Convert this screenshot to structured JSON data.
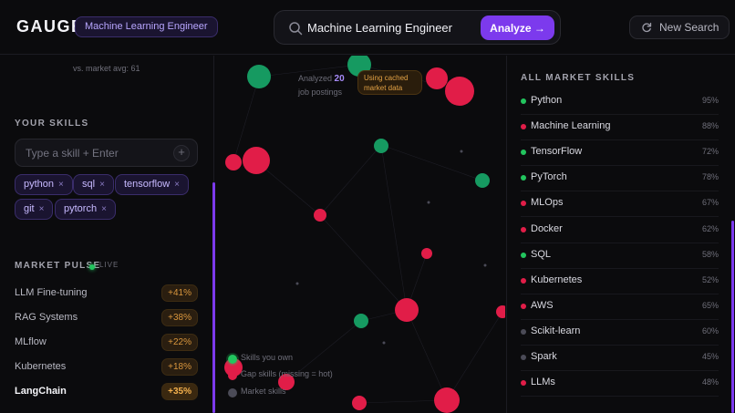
{
  "header": {
    "logo": "GAUGE",
    "role_badge": "Machine Learning Engineer",
    "search_value": "Machine Learning Engineer",
    "analyze_label": "Analyze →",
    "new_search_label": "New Search"
  },
  "left": {
    "market_avg_text": "vs. market avg: 61",
    "your_skills_title": "YOUR SKILLS",
    "skill_input_placeholder": "Type a skill + Enter",
    "add_symbol": "+",
    "chips": [
      "python",
      "sql",
      "tensorflow",
      "git",
      "pytorch"
    ],
    "chip_remove": "×",
    "market_pulse_title": "MARKET PULSE",
    "live_label": "LIVE",
    "pulse": [
      {
        "name": "LLM Fine-tuning",
        "delta": "+41%"
      },
      {
        "name": "RAG Systems",
        "delta": "+38%"
      },
      {
        "name": "MLflow",
        "delta": "+22%"
      },
      {
        "name": "Kubernetes",
        "delta": "+18%"
      },
      {
        "name": "LangChain",
        "delta": "+35%"
      }
    ]
  },
  "center": {
    "analyzed_prefix": "Analyzed",
    "analyzed_count": "20",
    "analyzed_suffix": "job postings",
    "cached_badge": "Using cached market data",
    "legend": [
      {
        "label": "Skills you own",
        "color": "#22c55e"
      },
      {
        "label": "Gap skills (missing = hot)",
        "color": "#e11d48"
      },
      {
        "label": "Market skills",
        "color": "#4b4b57"
      }
    ]
  },
  "right": {
    "title": "ALL MARKET SKILLS",
    "skills": [
      {
        "name": "Python",
        "pct": "95%",
        "color": "#22c55e"
      },
      {
        "name": "Machine Learning",
        "pct": "88%",
        "color": "#e11d48"
      },
      {
        "name": "TensorFlow",
        "pct": "72%",
        "color": "#22c55e"
      },
      {
        "name": "PyTorch",
        "pct": "78%",
        "color": "#22c55e"
      },
      {
        "name": "MLOps",
        "pct": "67%",
        "color": "#e11d48"
      },
      {
        "name": "Docker",
        "pct": "62%",
        "color": "#e11d48"
      },
      {
        "name": "SQL",
        "pct": "58%",
        "color": "#22c55e"
      },
      {
        "name": "Kubernetes",
        "pct": "52%",
        "color": "#e11d48"
      },
      {
        "name": "AWS",
        "pct": "65%",
        "color": "#e11d48"
      },
      {
        "name": "Scikit-learn",
        "pct": "60%",
        "color": "#4b4b57"
      },
      {
        "name": "Spark",
        "pct": "45%",
        "color": "#4b4b57"
      },
      {
        "name": "LLMs",
        "pct": "48%",
        "color": "#e11d48"
      }
    ]
  },
  "colors": {
    "accent": "#7c3aed",
    "owned": "#22c55e",
    "gap": "#e11d48",
    "market": "#4b4b57"
  }
}
